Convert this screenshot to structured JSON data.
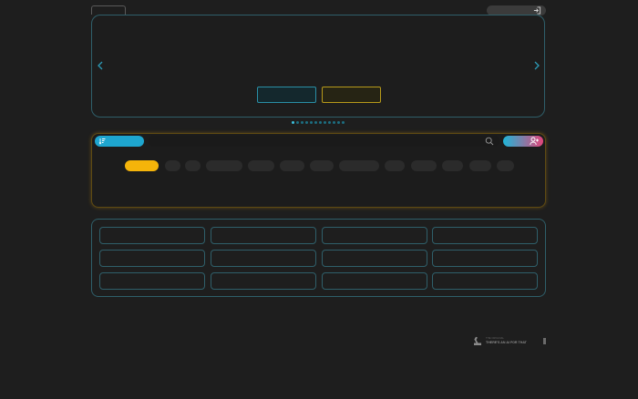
{
  "colors": {
    "background": "#1e1e1e",
    "accent_cyan": "#1ea6cf",
    "accent_gold": "#f5b40a",
    "accent_pink": "#e3467a",
    "outline_teal": "#2f5f6a"
  },
  "header": {
    "login_icon": "login-icon"
  },
  "hero": {
    "prev_icon": "chevron-left-icon",
    "next_icon": "chevron-right-icon",
    "slide_count": 12,
    "active_slide": 0
  },
  "search": {
    "sort_icon": "sort-icon",
    "search_icon": "search-icon",
    "add_user_icon": "user-plus-icon"
  },
  "filters": {
    "active_index": 0,
    "count": 13
  },
  "grid": {
    "rows": 3,
    "columns": 4
  },
  "footer": {
    "small_text": "THE ORIGINAL",
    "tagline": "THERE'S AN AI FOR THAT",
    "logo_icon": "robot-arm-icon"
  }
}
